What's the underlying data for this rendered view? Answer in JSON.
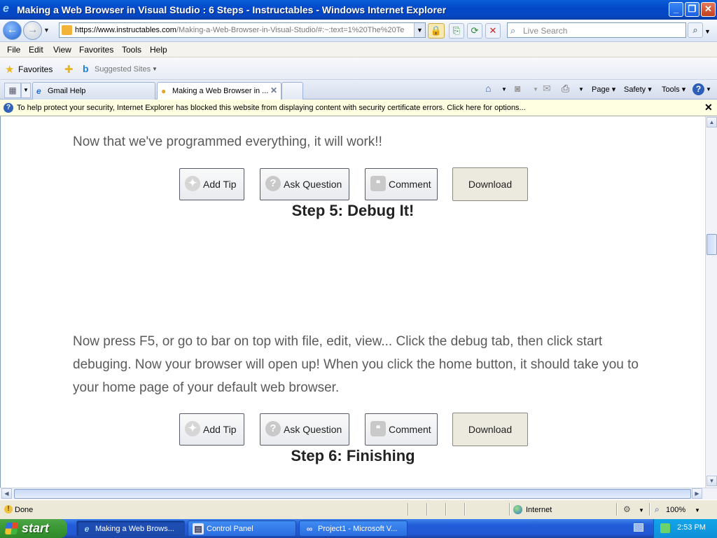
{
  "window": {
    "title": "Making a Web Browser in Visual Studio : 6 Steps - Instructables - Windows Internet Explorer",
    "min": "_",
    "max": "❐",
    "close": "✕"
  },
  "address": {
    "url_host": "https://www.instructables.com",
    "url_path": "/Making-a-Web-Browser-in-Visual-Studio/#:~:text=1%20The%20Te",
    "search_placeholder": "Live Search"
  },
  "menu": [
    "File",
    "Edit",
    "View",
    "Favorites",
    "Tools",
    "Help"
  ],
  "favorites": {
    "label": "Favorites",
    "suggested": "Suggested Sites"
  },
  "tabs": [
    {
      "label": "Gmail Help",
      "active": false
    },
    {
      "label": "Making a Web Browser in ...",
      "active": true
    }
  ],
  "commandbar": {
    "page": "Page",
    "safety": "Safety",
    "tools": "Tools"
  },
  "infobar": {
    "text": "To help protect your security, Internet Explorer has blocked this website from displaying content with security certificate errors. Click here for options..."
  },
  "content": {
    "para1": "Now that we've programmed everything, it will work!!",
    "step5": "Step 5: Debug It!",
    "para2": "Now press F5, or go to bar on top with file, edit, view... Click the debug tab, then click start debuging. Now your browser will open up! When you click the home button, it should take you to your home page of your default web browser.",
    "step6": "Step 6: Finishing",
    "buttons": {
      "add_tip": "Add Tip",
      "ask_question": "Ask Question",
      "comment": "Comment",
      "download": "Download"
    }
  },
  "status": {
    "text": "Done",
    "zone": "Internet",
    "zoom": "100%"
  },
  "taskbar": {
    "start": "start",
    "items": [
      {
        "label": "Making a Web Brows...",
        "active": true
      },
      {
        "label": "Control Panel",
        "active": false
      },
      {
        "label": "Project1 - Microsoft V...",
        "active": false
      }
    ],
    "clock": "2:53 PM"
  }
}
